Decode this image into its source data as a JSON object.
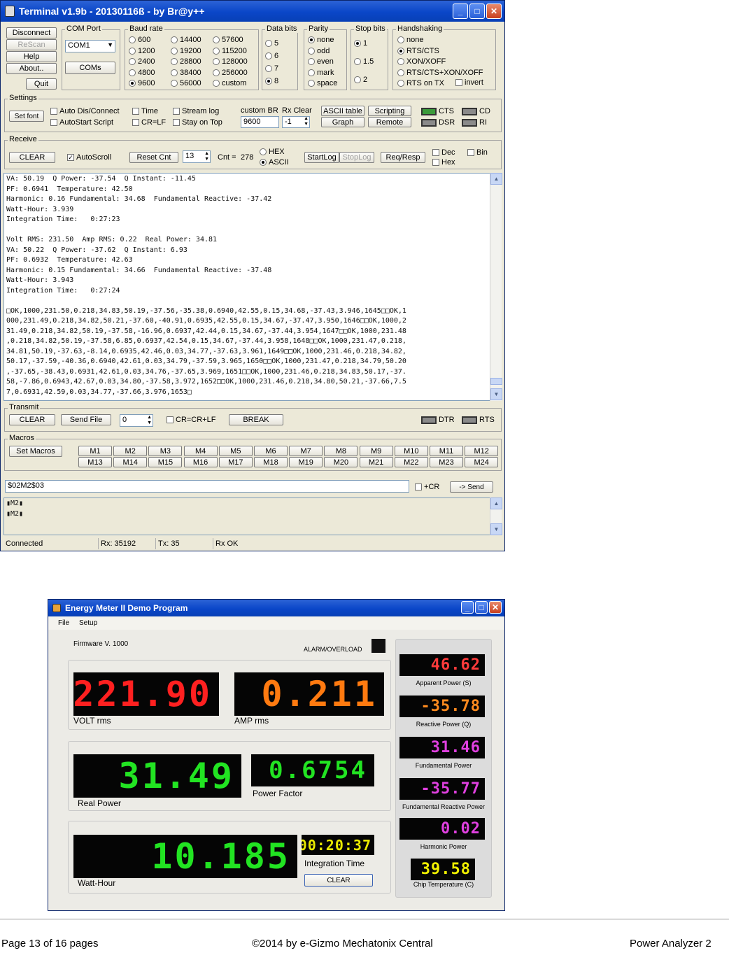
{
  "terminal": {
    "title": "Terminal v1.9b - 20130116ß - by Br@y++",
    "left_buttons": [
      "Disconnect",
      "ReScan",
      "Help",
      "About..",
      "Quit"
    ],
    "com_port": {
      "label": "COM Port",
      "selected": "COM1",
      "coms_button": "COMs"
    },
    "baud": {
      "label": "Baud rate",
      "options": [
        "600",
        "1200",
        "2400",
        "4800",
        "9600",
        "14400",
        "19200",
        "28800",
        "38400",
        "56000",
        "57600",
        "115200",
        "128000",
        "256000",
        "custom"
      ],
      "selected": "9600"
    },
    "data_bits": {
      "label": "Data bits",
      "options": [
        "5",
        "6",
        "7",
        "8"
      ],
      "selected": "8"
    },
    "parity": {
      "label": "Parity",
      "options": [
        "none",
        "odd",
        "even",
        "mark",
        "space"
      ],
      "selected": "none"
    },
    "stop_bits": {
      "label": "Stop bits",
      "options": [
        "1",
        "1.5",
        "2"
      ],
      "selected": "1"
    },
    "handshaking": {
      "label": "Handshaking",
      "options": [
        "none",
        "RTS/CTS",
        "XON/XOFF",
        "RTS/CTS+XON/XOFF",
        "RTS on TX"
      ],
      "selected": "RTS/CTS",
      "invert": "invert"
    },
    "settings": {
      "label": "Settings",
      "set_font": "Set font",
      "checks": [
        "Auto Dis/Connect",
        "AutoStart Script",
        "Time",
        "CR=LF",
        "Stream log",
        "Stay on Top"
      ],
      "custom_br_label": "custom BR",
      "custom_br_value": "9600",
      "rx_clear_label": "Rx Clear",
      "rx_clear_value": "-1",
      "ascii_table": "ASCII table",
      "graph": "Graph",
      "scripting": "Scripting",
      "remote": "Remote",
      "leds": [
        "CTS",
        "CD",
        "DSR",
        "RI"
      ]
    },
    "receive": {
      "label": "Receive",
      "clear": "CLEAR",
      "autoscroll": "AutoScroll",
      "reset_cnt": "Reset Cnt",
      "reset_value": "13",
      "cnt_label": "Cnt =",
      "cnt_value": "278",
      "hex": "HEX",
      "ascii": "ASCII",
      "startlog": "StartLog",
      "stoplog": "StopLog",
      "req_resp": "Req/Resp",
      "dec": "Dec",
      "hex_chk": "Hex",
      "bin": "Bin"
    },
    "output_lines": [
      "VA: 50.19  Q Power: -37.54  Q Instant: -11.45",
      "PF: 0.6941  Temperature: 42.50",
      "Harmonic: 0.16 Fundamental: 34.68  Fundamental Reactive: -37.42",
      "Watt-Hour: 3.939",
      "Integration Time:   0:27:23",
      "",
      "Volt RMS: 231.50  Amp RMS: 0.22  Real Power: 34.81",
      "VA: 50.22  Q Power: -37.62  Q Instant: 6.93",
      "PF: 0.6932  Temperature: 42.63",
      "Harmonic: 0.15 Fundamental: 34.66  Fundamental Reactive: -37.48",
      "Watt-Hour: 3.943",
      "Integration Time:   0:27:24",
      "",
      "□OK,1000,231.50,0.218,34.83,50.19,-37.56,-35.38,0.6940,42.55,0.15,34.68,-37.43,3.946,1645□□OK,1",
      "000,231.49,0.218,34.82,50.21,-37.60,-40.91,0.6935,42.55,0.15,34.67,-37.47,3.950,1646□□OK,1000,2",
      "31.49,0.218,34.82,50.19,-37.58,-16.96,0.6937,42.44,0.15,34.67,-37.44,3.954,1647□□OK,1000,231.48",
      ",0.218,34.82,50.19,-37.58,6.85,0.6937,42.54,0.15,34.67,-37.44,3.958,1648□□OK,1000,231.47,0.218,",
      "34.81,50.19,-37.63,-8.14,0.6935,42.46,0.03,34.77,-37.63,3.961,1649□□OK,1000,231.46,0.218,34.82,",
      "50.17,-37.59,-40.36,0.6940,42.61,0.03,34.79,-37.59,3.965,1650□□OK,1000,231.47,0.218,34.79,50.20",
      ",-37.65,-38.43,0.6931,42.61,0.03,34.76,-37.65,3.969,1651□□OK,1000,231.46,0.218,34.83,50.17,-37.",
      "58,-7.86,0.6943,42.67,0.03,34.80,-37.58,3.972,1652□□OK,1000,231.46,0.218,34.80,50.21,-37.66,7.5",
      "7,0.6931,42.59,0.03,34.77,-37.66,3.976,1653□"
    ],
    "transmit": {
      "label": "Transmit",
      "clear": "CLEAR",
      "send_file": "Send File",
      "value": "0",
      "crlf": "CR=CR+LF",
      "break": "BREAK",
      "leds": [
        "DTR",
        "RTS"
      ]
    },
    "macros": {
      "label": "Macros",
      "set_macros": "Set Macros",
      "items": [
        "M1",
        "M2",
        "M3",
        "M4",
        "M5",
        "M6",
        "M7",
        "M8",
        "M9",
        "M10",
        "M11",
        "M12",
        "M13",
        "M14",
        "M15",
        "M16",
        "M17",
        "M18",
        "M19",
        "M20",
        "M21",
        "M22",
        "M23",
        "M24"
      ]
    },
    "send_input": "$02M2$03",
    "plus_cr": "+CR",
    "send_button": "-> Send",
    "sent_lines": [
      "▮M2▮",
      "▮M2▮"
    ],
    "status": [
      "Connected",
      "Rx: 35192",
      "Tx: 35",
      "Rx OK"
    ]
  },
  "meter": {
    "title": "Energy Meter II Demo Program",
    "menu": [
      "File",
      "Setup"
    ],
    "firmware_label": "Firmware V.",
    "firmware_value": "1000",
    "alarm": "ALARM/OVERLOAD",
    "volt": {
      "value": "221.90",
      "label": "VOLT rms"
    },
    "amp": {
      "value": "0.211",
      "label": "AMP rms"
    },
    "real_power": {
      "value": "31.49",
      "label": "Real Power"
    },
    "power_factor": {
      "value": "0.6754",
      "label": "Power Factor"
    },
    "watt_hour": {
      "value": "10.185",
      "label": "Watt-Hour"
    },
    "integration_time": {
      "value": "00:20:37",
      "label": "Integration Time"
    },
    "clear_button": "CLEAR",
    "side": [
      {
        "value": "46.62",
        "label": "Apparent Power (S)",
        "color": "#ff3b3b"
      },
      {
        "value": "-35.78",
        "label": "Reactive Power (Q)",
        "color": "#ff8a1e"
      },
      {
        "value": "31.46",
        "label": "Fundamental Power",
        "color": "#e040e0"
      },
      {
        "value": "-35.77",
        "label": "Fundamental Reactive Power",
        "color": "#e040e0"
      },
      {
        "value": "0.02",
        "label": "Harmonic Power",
        "color": "#e040e0"
      },
      {
        "value": "39.58",
        "label": "Chip Temperature (C)",
        "color": "#f0f000"
      }
    ],
    "colors": {
      "volt": "#ff2020",
      "amp": "#ff7a10",
      "green": "#22e422",
      "yellow": "#e8e800"
    }
  },
  "footer": {
    "page": "Page 13 of 16 pages",
    "copyright": "©2014 by e-Gizmo Mechatonix Central",
    "product": "Power Analyzer 2"
  }
}
